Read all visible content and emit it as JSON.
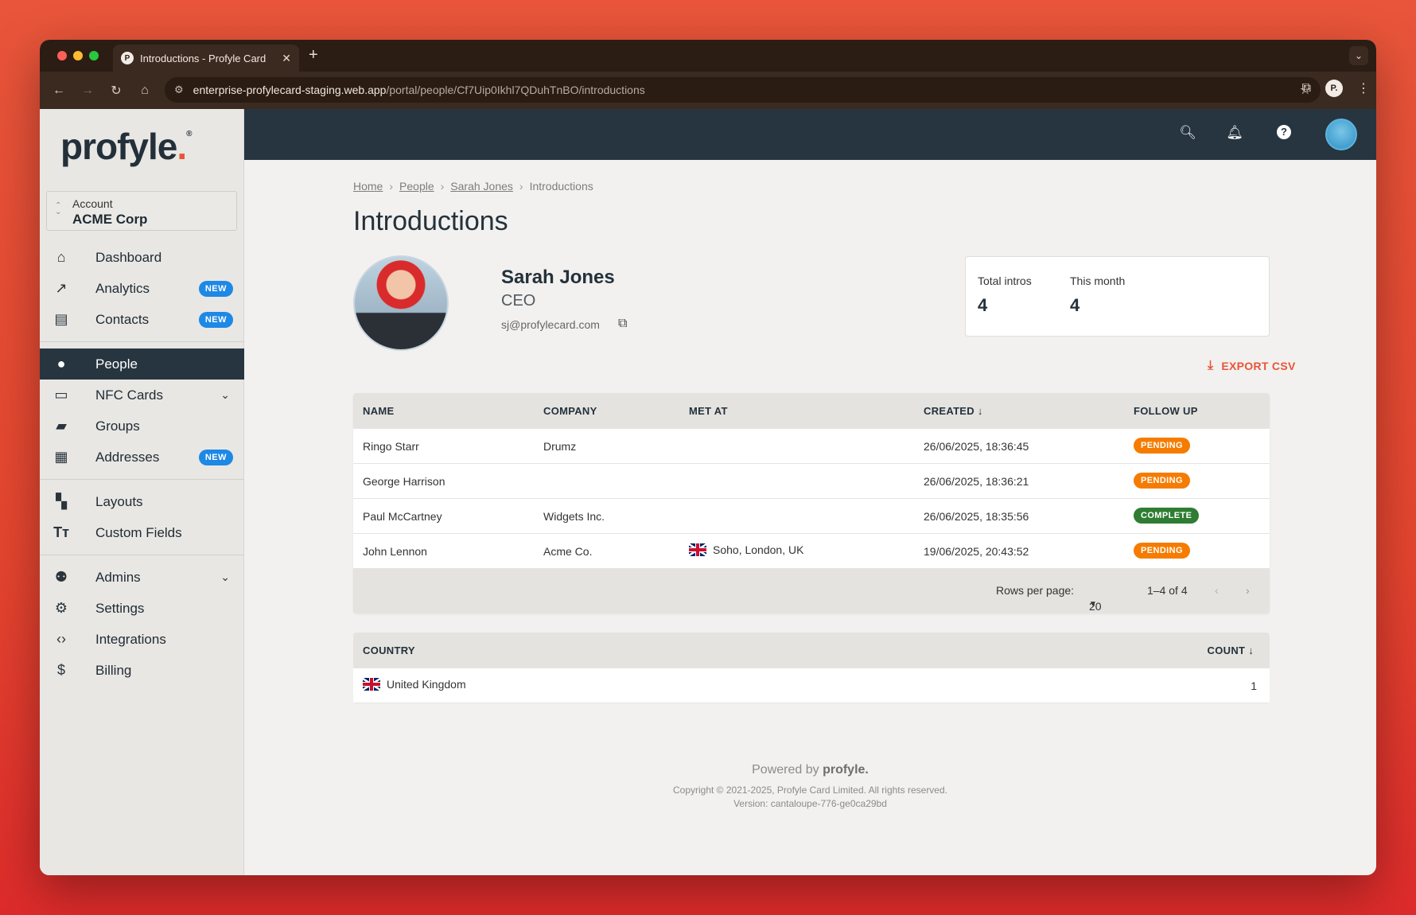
{
  "browser": {
    "tab_title": "Introductions - Profyle Card",
    "tab_favicon": "P",
    "url_host": "enterprise-profylecard-staging.web.app",
    "url_path": "/portal/people/Cf7Uip0Ikhl7QDuhTnBO/introductions",
    "profile_initial": "P."
  },
  "sidebar": {
    "logo": "profyle",
    "account_label": "Account",
    "account_value": "ACME Corp",
    "items": [
      {
        "label": "Dashboard",
        "icon": "home-icon"
      },
      {
        "label": "Analytics",
        "icon": "trending-up-icon",
        "badge": "NEW"
      },
      {
        "label": "Contacts",
        "icon": "contacts-icon",
        "badge": "NEW"
      },
      {
        "label": "People",
        "icon": "person-icon"
      },
      {
        "label": "NFC Cards",
        "icon": "card-icon"
      },
      {
        "label": "Groups",
        "icon": "folder-shared-icon"
      },
      {
        "label": "Addresses",
        "icon": "building-icon",
        "badge": "NEW"
      },
      {
        "label": "Layouts",
        "icon": "dashboard-layout-icon"
      },
      {
        "label": "Custom Fields",
        "icon": "text-fields-icon"
      },
      {
        "label": "Admins",
        "icon": "group-icon"
      },
      {
        "label": "Settings",
        "icon": "gear-icon"
      },
      {
        "label": "Integrations",
        "icon": "code-icon"
      },
      {
        "label": "Billing",
        "icon": "dollar-icon"
      }
    ]
  },
  "breadcrumb": {
    "home": "Home",
    "people": "People",
    "person": "Sarah Jones",
    "current": "Introductions"
  },
  "page": {
    "title": "Introductions"
  },
  "person": {
    "name": "Sarah Jones",
    "role": "CEO",
    "email": "sj@profylecard.com"
  },
  "stats": {
    "total_label": "Total intros",
    "total_value": "4",
    "month_label": "This month",
    "month_value": "4"
  },
  "export_label": "EXPORT CSV",
  "table": {
    "headers": {
      "name": "NAME",
      "company": "COMPANY",
      "met_at": "MET AT",
      "created": "CREATED",
      "follow_up": "FOLLOW UP"
    },
    "rows": [
      {
        "name": "Ringo Starr",
        "company": "Drumz",
        "met_at": "",
        "created": "26/06/2025, 18:36:45",
        "status": "PENDING"
      },
      {
        "name": "George Harrison",
        "company": "",
        "met_at": "",
        "created": "26/06/2025, 18:36:21",
        "status": "PENDING"
      },
      {
        "name": "Paul McCartney",
        "company": "Widgets Inc.",
        "met_at": "",
        "created": "26/06/2025, 18:35:56",
        "status": "COMPLETE"
      },
      {
        "name": "John Lennon",
        "company": "Acme Co.",
        "met_at": "Soho, London, UK",
        "created": "19/06/2025, 20:43:52",
        "status": "PENDING"
      }
    ],
    "rows_per_page_label": "Rows per page:",
    "rows_per_page_value": "20",
    "range": "1–4 of 4"
  },
  "country_table": {
    "headers": {
      "country": "COUNTRY",
      "count": "COUNT"
    },
    "rows": [
      {
        "country": "United Kingdom",
        "count": "1"
      }
    ]
  },
  "footer": {
    "powered_prefix": "Powered by",
    "powered_brand": "profyle.",
    "copyright": "Copyright © 2021-2025, Profyle Card Limited. All rights reserved.",
    "version": "Version: cantaloupe-776-ge0ca29bd"
  },
  "colors": {
    "accent": "#e8553a",
    "navy": "#263540",
    "badge_blue": "#1e88e5",
    "pending": "#f57c00",
    "complete": "#2e7d32"
  }
}
